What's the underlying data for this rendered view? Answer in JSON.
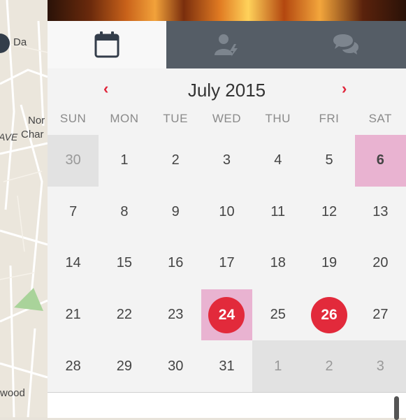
{
  "map": {
    "labels": [
      "Da",
      "Nor",
      "AVE",
      "Char",
      "wood"
    ]
  },
  "tabs": [
    {
      "name": "calendar",
      "icon": "calendar-icon",
      "active": true
    },
    {
      "name": "attendees",
      "icon": "user-lightning-icon",
      "active": false
    },
    {
      "name": "chat",
      "icon": "chat-bubbles-icon",
      "active": false
    }
  ],
  "calendar": {
    "month_label": "July 2015",
    "prev_icon": "chevron-left-icon",
    "next_icon": "chevron-right-icon",
    "weekdays": [
      "SUN",
      "MON",
      "TUE",
      "WED",
      "THU",
      "FRI",
      "SAT"
    ],
    "colors": {
      "accent": "#e22a3b",
      "highlight": "#e9b3d1",
      "other_month": "#e2e2e2"
    },
    "weeks": [
      [
        {
          "d": "30",
          "other": true
        },
        {
          "d": "1"
        },
        {
          "d": "2"
        },
        {
          "d": "3"
        },
        {
          "d": "4"
        },
        {
          "d": "5"
        },
        {
          "d": "6",
          "highlight": true,
          "bold": true
        }
      ],
      [
        {
          "d": "7"
        },
        {
          "d": "8"
        },
        {
          "d": "9"
        },
        {
          "d": "10"
        },
        {
          "d": "11"
        },
        {
          "d": "12"
        },
        {
          "d": "13"
        }
      ],
      [
        {
          "d": "14"
        },
        {
          "d": "15"
        },
        {
          "d": "16"
        },
        {
          "d": "17"
        },
        {
          "d": "18"
        },
        {
          "d": "19"
        },
        {
          "d": "20"
        }
      ],
      [
        {
          "d": "21"
        },
        {
          "d": "22"
        },
        {
          "d": "23"
        },
        {
          "d": "24",
          "highlight": true,
          "event": true
        },
        {
          "d": "25"
        },
        {
          "d": "26",
          "event": true
        },
        {
          "d": "27"
        }
      ],
      [
        {
          "d": "28"
        },
        {
          "d": "29"
        },
        {
          "d": "30"
        },
        {
          "d": "31"
        },
        {
          "d": "1",
          "other": true
        },
        {
          "d": "2",
          "other": true
        },
        {
          "d": "3",
          "other": true
        }
      ]
    ]
  }
}
